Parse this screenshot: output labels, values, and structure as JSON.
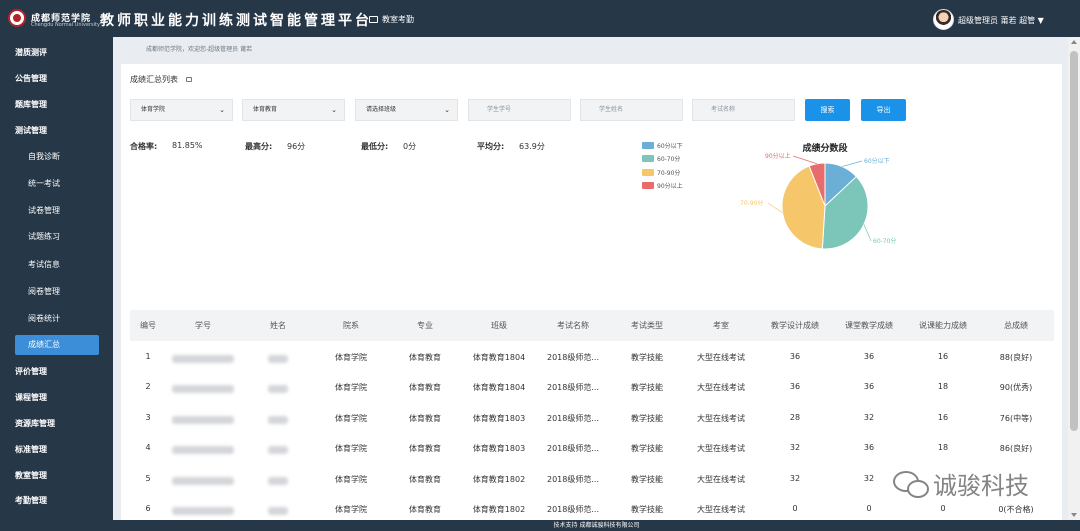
{
  "header": {
    "school_name": "成都师范学院",
    "school_en": "Chengdu Normal University",
    "platform_title": "教师职业能力训练测试智能管理平台",
    "attend_label": "教室考勤",
    "user_label": "超级管理员 莆若 超管 ▼"
  },
  "sidebar": {
    "items": [
      {
        "label": "潜质测评"
      },
      {
        "label": "公告管理"
      },
      {
        "label": "题库管理"
      },
      {
        "label": "测试管理"
      },
      {
        "label": "自我诊断"
      },
      {
        "label": "统一考试"
      },
      {
        "label": "试卷管理"
      },
      {
        "label": "试题练习"
      },
      {
        "label": "考试信息"
      },
      {
        "label": "阅卷管理"
      },
      {
        "label": "阅卷统计"
      },
      {
        "label": "成绩汇总"
      },
      {
        "label": "评价管理"
      },
      {
        "label": "课程管理"
      },
      {
        "label": "资源库管理"
      },
      {
        "label": "标准管理"
      },
      {
        "label": "教室管理"
      },
      {
        "label": "考勤管理"
      }
    ]
  },
  "breadcrumb": "成都师范学院，欢迎您-超级管理员 莆若",
  "panel_title": "成绩汇总列表",
  "filters": {
    "college": "体育学院",
    "major": "体育教育",
    "class_placeholder": "请选择班级",
    "student_no_placeholder": "学生学号",
    "student_name_placeholder": "学生姓名",
    "exam_name_placeholder": "考试名称",
    "search_label": "搜索",
    "export_label": "导出"
  },
  "stats": {
    "pass_label": "合格率:",
    "pass_value": "81.85%",
    "max_label": "最高分:",
    "max_value": "96分",
    "min_label": "最低分:",
    "min_value": "0分",
    "avg_label": "平均分:",
    "avg_value": "63.9分"
  },
  "chart_data": {
    "type": "pie",
    "title": "成绩分数段",
    "legend_position": "left",
    "labels": [
      "60分以下",
      "60-70分",
      "70-90分",
      "90分以上"
    ],
    "values": [
      13,
      38,
      43,
      6
    ],
    "colors": [
      "#6baed6",
      "#7cc5b9",
      "#f5c76a",
      "#e86c6c"
    ]
  },
  "table": {
    "headers": [
      "编号",
      "学号",
      "姓名",
      "院系",
      "专业",
      "班级",
      "考试名称",
      "考试类型",
      "考室",
      "教学设计成绩",
      "课堂教学成绩",
      "说课能力成绩",
      "总成绩"
    ],
    "rows": [
      {
        "no": "1",
        "college": "体育学院",
        "major": "体育教育",
        "class": "体育教育1804",
        "exam": "2018级师范...",
        "type": "教学技能",
        "room": "大型在线考试",
        "design": "36",
        "teaching": "36",
        "speaking": "16",
        "total": "88(良好)"
      },
      {
        "no": "2",
        "college": "体育学院",
        "major": "体育教育",
        "class": "体育教育1804",
        "exam": "2018级师范...",
        "type": "教学技能",
        "room": "大型在线考试",
        "design": "36",
        "teaching": "36",
        "speaking": "18",
        "total": "90(优秀)"
      },
      {
        "no": "3",
        "college": "体育学院",
        "major": "体育教育",
        "class": "体育教育1803",
        "exam": "2018级师范...",
        "type": "教学技能",
        "room": "大型在线考试",
        "design": "28",
        "teaching": "32",
        "speaking": "16",
        "total": "76(中等)"
      },
      {
        "no": "4",
        "college": "体育学院",
        "major": "体育教育",
        "class": "体育教育1803",
        "exam": "2018级师范...",
        "type": "教学技能",
        "room": "大型在线考试",
        "design": "32",
        "teaching": "36",
        "speaking": "18",
        "total": "86(良好)"
      },
      {
        "no": "5",
        "college": "体育学院",
        "major": "体育教育",
        "class": "体育教育1802",
        "exam": "2018级师范...",
        "type": "教学技能",
        "room": "大型在线考试",
        "design": "32",
        "teaching": "32",
        "speaking": "",
        "total": ""
      },
      {
        "no": "6",
        "college": "体育学院",
        "major": "体育教育",
        "class": "体育教育1802",
        "exam": "2018级师范...",
        "type": "教学技能",
        "room": "大型在线考试",
        "design": "0",
        "teaching": "0",
        "speaking": "0",
        "total": "0(不合格)"
      }
    ]
  },
  "footer": "技术支持 成都诚骏科技有限公司",
  "watermark": "诚骏科技",
  "icons": {
    "logo": "university-seal-icon",
    "attend": "monitor-icon",
    "title": "print-icon",
    "chevron": "chevron-down-icon",
    "watermark": "wechat-icon"
  }
}
